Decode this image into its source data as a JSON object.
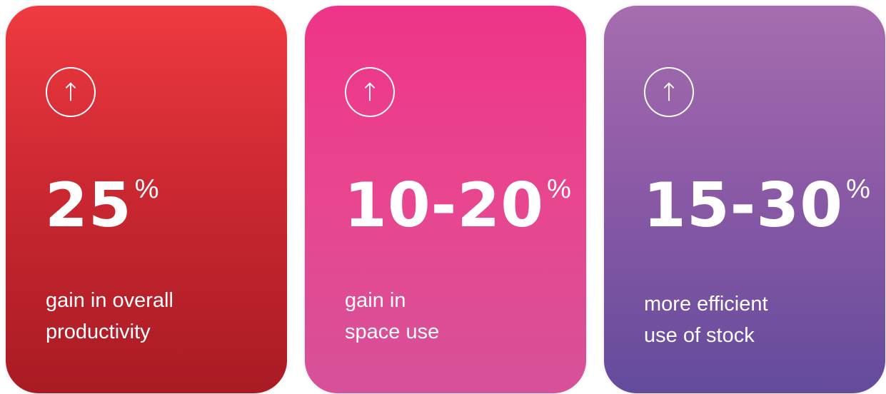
{
  "cards": [
    {
      "icon": "arrow-up-circle-icon",
      "value": "25",
      "unit": "%",
      "line1": "gain in overall",
      "line2": "productivity",
      "colors": [
        "#ef3a40",
        "#a91b24"
      ]
    },
    {
      "icon": "arrow-up-circle-icon",
      "value": "10-20",
      "unit": "%",
      "line1": "gain in",
      "line2": "space use",
      "colors": [
        "#ef3488",
        "#d6519a"
      ]
    },
    {
      "icon": "arrow-up-circle-icon",
      "value": "15-30",
      "unit": "%",
      "line1": "more efficient",
      "line2": "use of stock",
      "colors": [
        "#a66daf",
        "#644b9c"
      ]
    }
  ]
}
